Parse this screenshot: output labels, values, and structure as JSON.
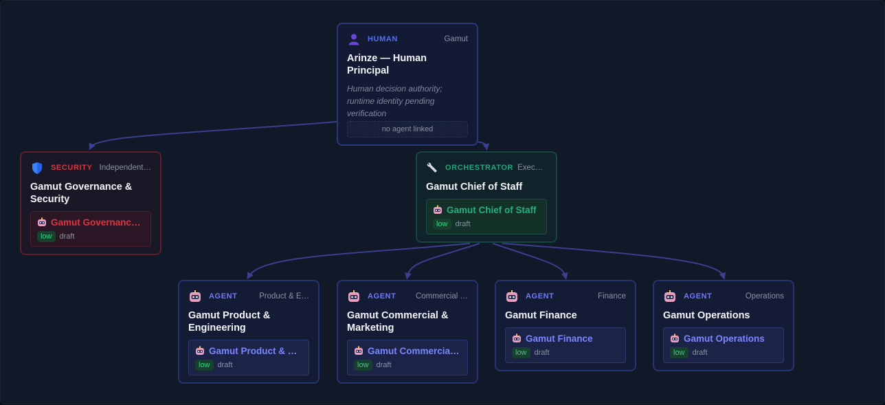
{
  "colors": {
    "human": "#4f6dff",
    "security": "#e0343f",
    "orchestrator": "#21a87a",
    "agent": "#7079ff",
    "edge": "#3a3f8f"
  },
  "human": {
    "role": "HUMAN",
    "dept": "Gamut",
    "title": "Arinze — Human Principal",
    "description": "Human decision authority; runtime identity pending verification",
    "link_status": "no agent linked",
    "icon": "person-icon"
  },
  "security": {
    "role": "SECURITY",
    "dept": "Independent…",
    "title": "Gamut Governance & Security",
    "icon": "shield-icon",
    "agent": {
      "name": "Gamut Governance…",
      "risk": "low",
      "status": "draft"
    }
  },
  "orchestrator": {
    "role": "ORCHESTRATOR",
    "dept": "Executi…",
    "title": "Gamut Chief of Staff",
    "icon": "wrench-icon",
    "agent": {
      "name": "Gamut Chief of Staff",
      "risk": "low",
      "status": "draft"
    }
  },
  "agents": [
    {
      "role": "AGENT",
      "dept": "Product & E…",
      "title": "Gamut Product & Engineering",
      "icon": "robot-icon",
      "agent": {
        "name": "Gamut Product & E…",
        "risk": "low",
        "status": "draft"
      }
    },
    {
      "role": "AGENT",
      "dept": "Commercial …",
      "title": "Gamut Commercial & Marketing",
      "icon": "robot-icon",
      "agent": {
        "name": "Gamut Commercial…",
        "risk": "low",
        "status": "draft"
      }
    },
    {
      "role": "AGENT",
      "dept": "Finance",
      "title": "Gamut Finance",
      "icon": "robot-icon",
      "agent": {
        "name": "Gamut Finance",
        "risk": "low",
        "status": "draft"
      }
    },
    {
      "role": "AGENT",
      "dept": "Operations",
      "title": "Gamut Operations",
      "icon": "robot-icon",
      "agent": {
        "name": "Gamut Operations",
        "risk": "low",
        "status": "draft"
      }
    }
  ]
}
